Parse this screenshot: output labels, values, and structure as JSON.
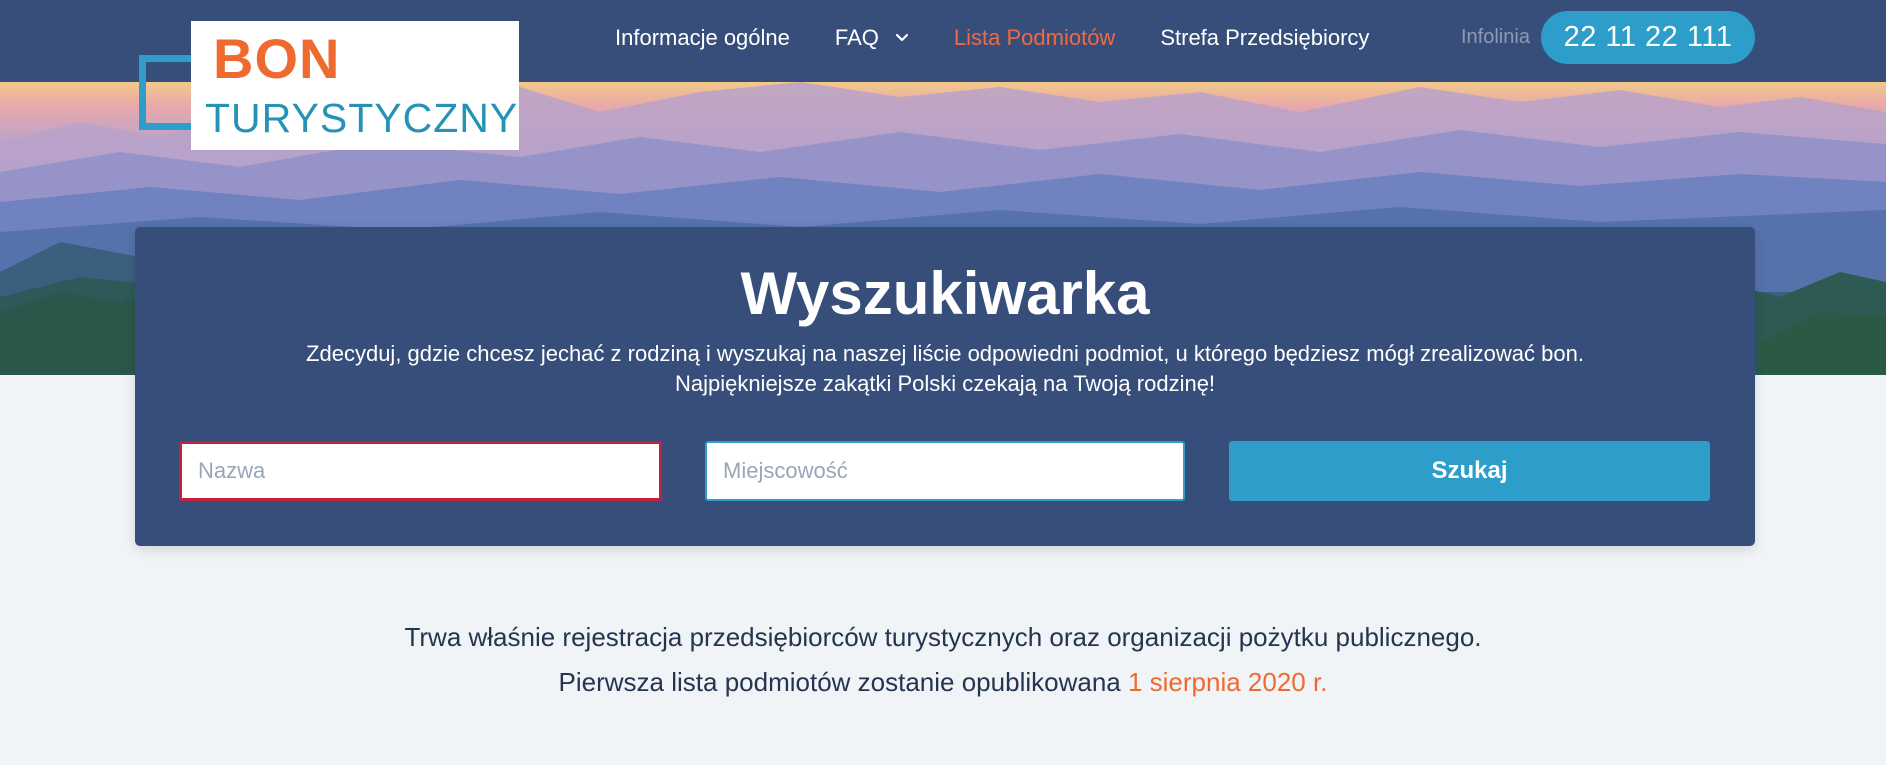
{
  "logo": {
    "line1": "BON",
    "line2": "TURYSTYCZNY"
  },
  "nav": {
    "items": [
      {
        "label": "Informacje ogólne"
      },
      {
        "label": "FAQ"
      },
      {
        "label": "Lista Podmiotów"
      },
      {
        "label": "Strefa Przedsiębiorcy"
      }
    ],
    "infolinia_label": "Infolinia",
    "phone": "22 11 22 111"
  },
  "search": {
    "title": "Wyszukiwarka",
    "subtitle_line1": "Zdecyduj, gdzie chcesz jechać z rodziną i wyszukaj na naszej liście odpowiedni podmiot, u którego będziesz mógł zrealizować bon.",
    "subtitle_line2": "Najpiękniejsze zakątki Polski czekają na Twoją rodzinę!",
    "name_placeholder": "Nazwa",
    "city_placeholder": "Miejscowość",
    "button_label": "Szukaj"
  },
  "info": {
    "line1": "Trwa właśnie rejestracja przedsiębiorców turystycznych oraz organizacji pożytku publicznego.",
    "line2_prefix": "Pierwsza lista podmiotów zostanie opublikowana",
    "line2_date": "1 sierpnia 2020 r."
  },
  "icons": {
    "faq_dropdown": "chevron-down-icon",
    "hero": "mountain-landscape"
  },
  "colors": {
    "navy": "#374e7a",
    "accent_orange": "#ef6a2e",
    "accent_blue": "#2d9dc9",
    "background": "#f0f4f7"
  }
}
